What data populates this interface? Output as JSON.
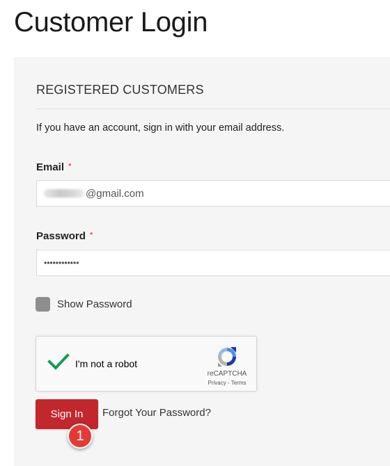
{
  "page_title": "Customer Login",
  "section": {
    "title": "REGISTERED CUSTOMERS",
    "intro": "If you have an account, sign in with your email address."
  },
  "email": {
    "label": "Email",
    "required_mark": "*",
    "value_visible": "@gmail.com"
  },
  "password": {
    "label": "Password",
    "required_mark": "*",
    "value_masked": "••••••••••••"
  },
  "show_password": {
    "label": "Show Password",
    "checked": false
  },
  "recaptcha": {
    "label": "I'm not a robot",
    "brand": "reCAPTCHA",
    "links": "Privacy - Terms"
  },
  "actions": {
    "sign_in_label": "Sign In",
    "forgot_label": "Forgot Your Password?"
  },
  "annotation": {
    "step_number": "1"
  },
  "colors": {
    "accent": "#c1272d",
    "required": "#e02b27",
    "badge": "#e53935",
    "panel_bg": "#f5f5f5"
  },
  "icons": [
    "checkmark-icon",
    "recaptcha-logo-icon"
  ]
}
